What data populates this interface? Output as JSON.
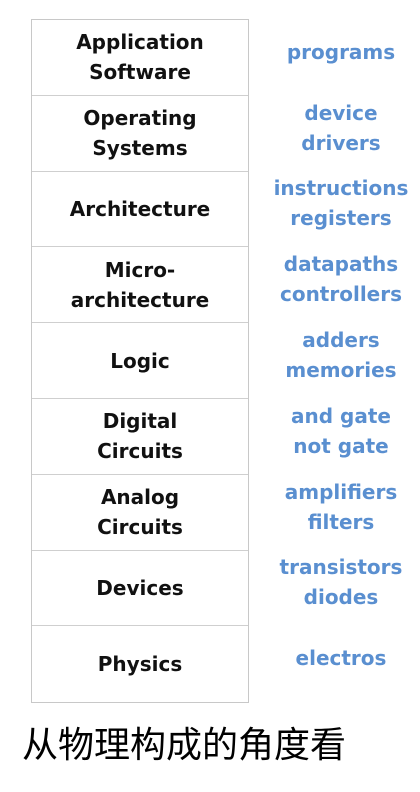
{
  "accent_color": "#5a8fd0",
  "layers": [
    {
      "name": "Application\nSoftware",
      "examples": "programs"
    },
    {
      "name": "Operating\nSystems",
      "examples": "device\ndrivers"
    },
    {
      "name": "Architecture",
      "examples": "instructions\nregisters"
    },
    {
      "name": "Micro-\narchitecture",
      "examples": "datapaths\ncontrollers"
    },
    {
      "name": "Logic",
      "examples": "adders\nmemories"
    },
    {
      "name": "Digital\nCircuits",
      "examples": "and  gate\nnot gate"
    },
    {
      "name": "Analog\nCircuits",
      "examples": "amplifiers\nfilters"
    },
    {
      "name": "Devices",
      "examples": "transistors\ndiodes"
    },
    {
      "name": "Physics",
      "examples": "electros"
    }
  ],
  "caption": "从物理构成的角度看"
}
